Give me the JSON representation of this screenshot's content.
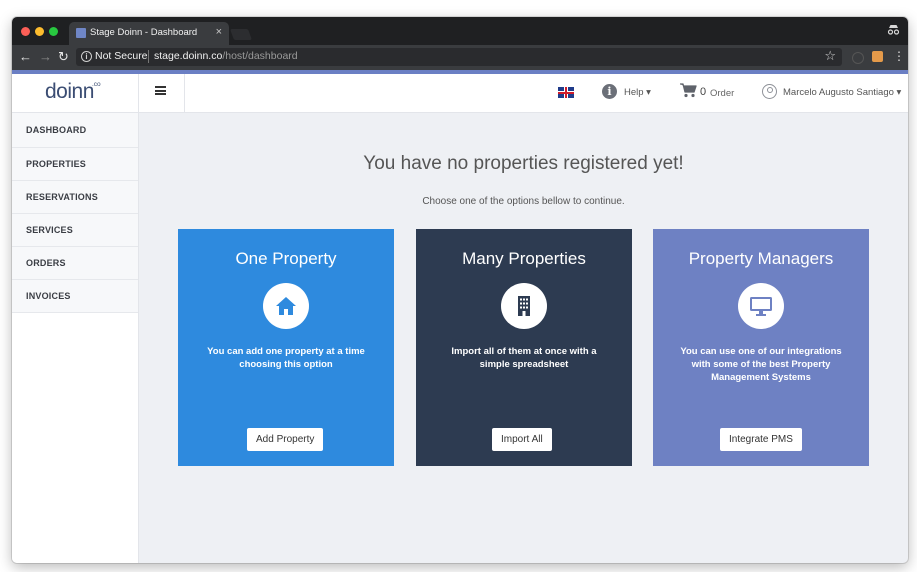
{
  "browser": {
    "tab_title": "Stage Doinn - Dashboard",
    "tab_close": "×",
    "security_label": "Not Secure",
    "url_host": "stage.doinn.co",
    "url_path": "/host/dashboard"
  },
  "header": {
    "logo_text": "doinn",
    "logo_sup": ".co",
    "language": "English (UK flag)",
    "help_label": "Help",
    "order_count": "0",
    "order_label": "Order",
    "user_name": "Marcelo Augusto Santiago"
  },
  "sidebar": {
    "items": [
      {
        "label": "DASHBOARD"
      },
      {
        "label": "PROPERTIES"
      },
      {
        "label": "RESERVATIONS"
      },
      {
        "label": "SERVICES"
      },
      {
        "label": "ORDERS"
      },
      {
        "label": "INVOICES"
      }
    ]
  },
  "main": {
    "title": "You have no properties registered yet!",
    "subtitle": "Choose one of the options bellow to continue.",
    "cards": [
      {
        "title": "One Property",
        "icon": "home-icon",
        "description": "You can add one property at a time choosing this option",
        "button": "Add Property",
        "color": "#2e8ade"
      },
      {
        "title": "Many Properties",
        "icon": "building-icon",
        "description": "Import all of them at once with a simple spreadsheet",
        "button": "Import All",
        "color": "#2d3b51"
      },
      {
        "title": "Property Managers",
        "icon": "desktop-icon",
        "description": "You can use one of our integrations with some of the best Property Management Systems",
        "button": "Integrate PMS",
        "color": "#6e81c3"
      }
    ]
  },
  "colors": {
    "accent": "#6b7fc4",
    "page_bg": "#eef0f4"
  }
}
